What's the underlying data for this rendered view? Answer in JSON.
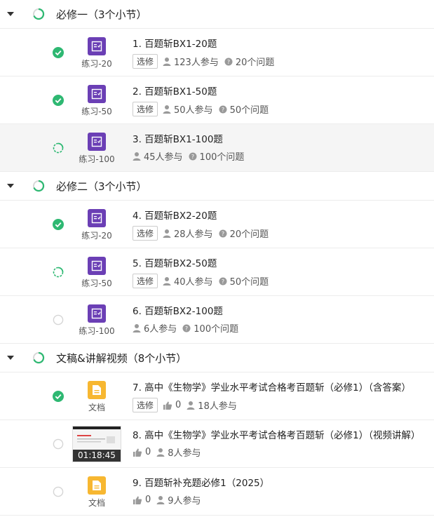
{
  "sections": [
    {
      "title": "必修一（3个小节）",
      "items": [
        {
          "title": "1. 百题斩BX1-20题",
          "label": "练习-20",
          "status": "done",
          "tag": "选修",
          "participants": "123人参与",
          "questions": "20个问题",
          "icon": "exercise-icon"
        },
        {
          "title": "2. 百题斩BX1-50题",
          "label": "练习-50",
          "status": "done",
          "tag": "选修",
          "participants": "50人参与",
          "questions": "50个问题",
          "icon": "exercise-icon"
        },
        {
          "title": "3. 百题斩BX1-100题",
          "label": "练习-100",
          "status": "progress",
          "tag": "",
          "participants": "45人参与",
          "questions": "100个问题",
          "icon": "exercise-icon",
          "active": true
        }
      ]
    },
    {
      "title": "必修二（3个小节）",
      "items": [
        {
          "title": "4. 百题斩BX2-20题",
          "label": "练习-20",
          "status": "done",
          "tag": "选修",
          "participants": "28人参与",
          "questions": "20个问题",
          "icon": "exercise-icon"
        },
        {
          "title": "5. 百题斩BX2-50题",
          "label": "练习-50",
          "status": "progress",
          "tag": "选修",
          "participants": "40人参与",
          "questions": "50个问题",
          "icon": "exercise-icon"
        },
        {
          "title": "6. 百题斩BX2-100题",
          "label": "练习-100",
          "status": "none",
          "tag": "",
          "participants": "6人参与",
          "questions": "100个问题",
          "icon": "exercise-icon"
        }
      ]
    },
    {
      "title": "文稿&讲解视频（8个小节）",
      "items": [
        {
          "title": "7. 高中《生物学》学业水平考试合格考百题斩（必修1）（含答案）",
          "label": "文档",
          "status": "done",
          "tag": "选修",
          "likes": "0",
          "participants": "18人参与",
          "icon": "document-icon"
        },
        {
          "title": "8. 高中《生物学》学业水平考试合格考百题斩（必修1）（视频讲解）",
          "label": "",
          "duration": "01:18:45",
          "status": "none",
          "tag": "",
          "likes": "0",
          "participants": "8人参与",
          "icon": "video-thumbnail"
        },
        {
          "title": "9. 百题斩补充题必修1（2025）",
          "label": "文档",
          "status": "none",
          "tag": "",
          "likes": "0",
          "participants": "9人参与",
          "icon": "document-icon"
        }
      ]
    }
  ],
  "colors": {
    "accent": "#2eb872",
    "exercise": "#6b3fb5",
    "document": "#f7b731"
  }
}
